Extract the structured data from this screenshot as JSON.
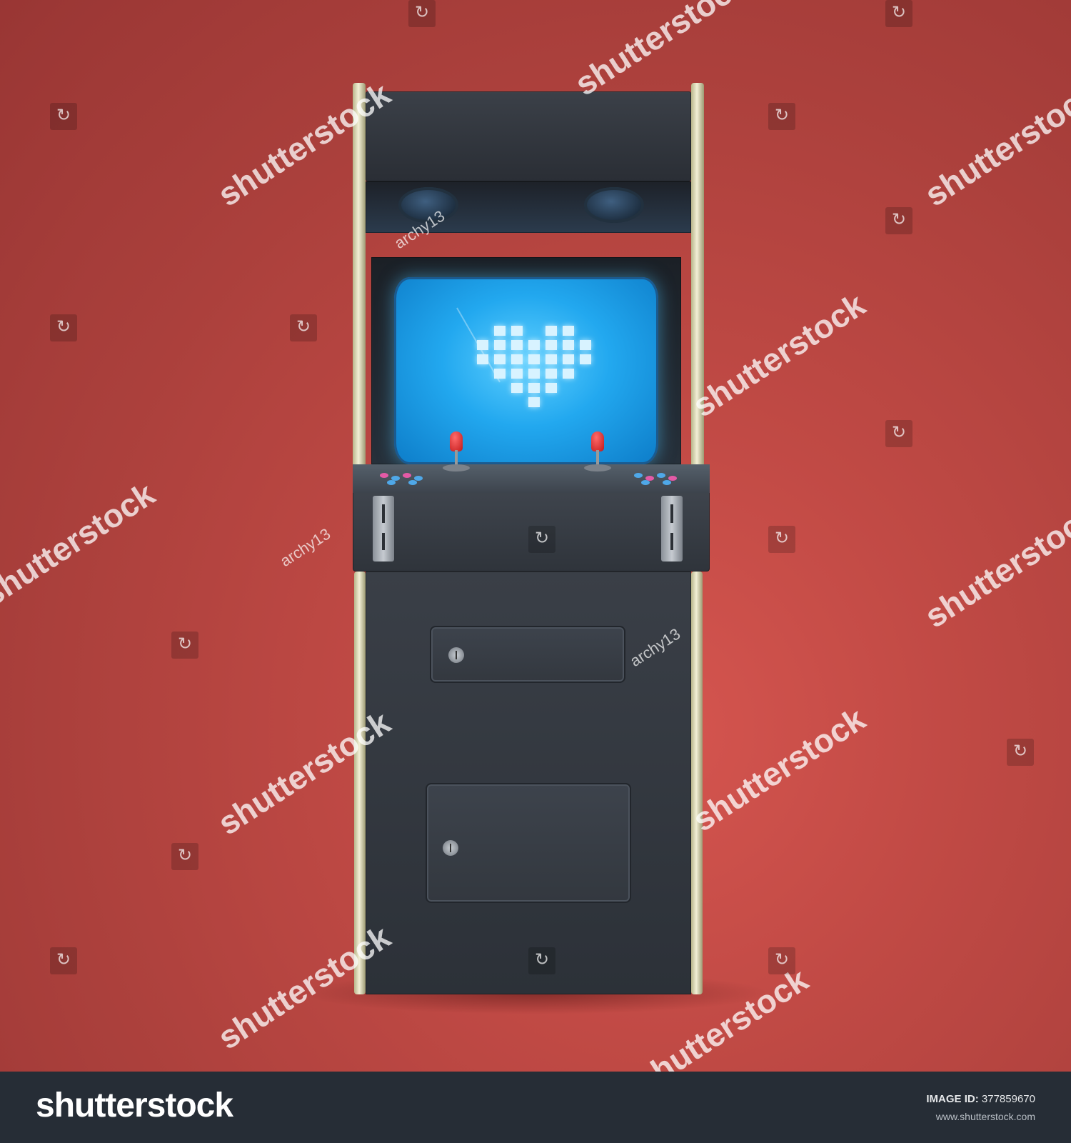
{
  "watermark": {
    "brand_text": "shutterstock",
    "contributor": "archy13"
  },
  "footer": {
    "brand": "shutterstock",
    "image_id_label": "IMAGE ID:",
    "image_id": "377859670",
    "site": "www.shutterstock.com"
  },
  "screen": {
    "icon": "pixel-heart-icon",
    "glow_color": "#22a8ef"
  },
  "colors": {
    "background": "#c14a45",
    "cabinet": "#2f343b",
    "trim": "#e9e6c8",
    "joystick": "#d42020",
    "footer": "#262d36"
  }
}
